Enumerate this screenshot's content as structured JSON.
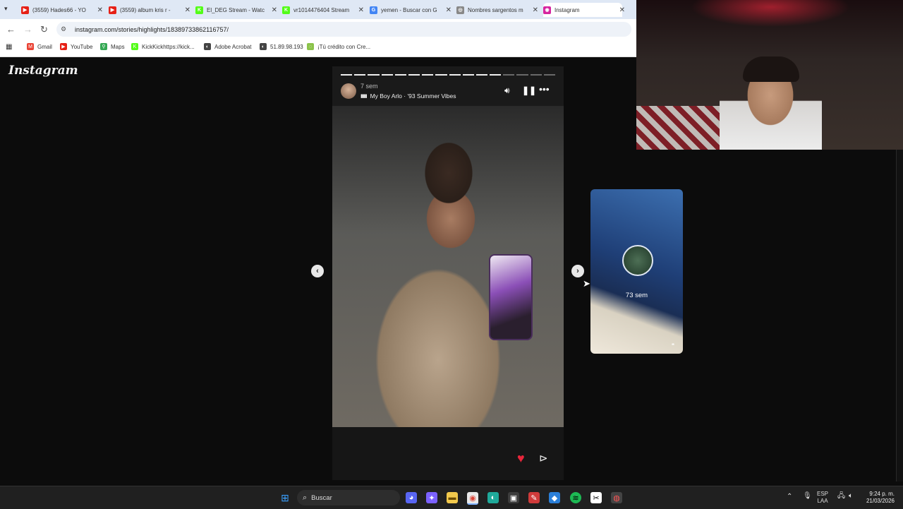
{
  "browser": {
    "tabs": [
      {
        "title": "(3559) Hades66 - YO",
        "color": "#e62117",
        "glyph": "▶"
      },
      {
        "title": "(3559) album kris r -",
        "color": "#e62117",
        "glyph": "▶"
      },
      {
        "title": "El_DEG Stream - Watc",
        "color": "#53fc18",
        "glyph": "K"
      },
      {
        "title": "vr1014476404 Stream",
        "color": "#53fc18",
        "glyph": "K"
      },
      {
        "title": "yemen - Buscar con G",
        "color": "#4285f4",
        "glyph": "G"
      },
      {
        "title": "Nombres sargentos m",
        "color": "#888888",
        "glyph": "◎"
      },
      {
        "title": "Instagram",
        "color": "#d6249f",
        "glyph": "◉"
      }
    ],
    "url": "instagram.com/stories/highlights/18389733862116757/",
    "bookmarks": [
      {
        "label": "Gmail",
        "color": "#ea4335",
        "glyph": "M"
      },
      {
        "label": "YouTube",
        "color": "#e62117",
        "glyph": "▶"
      },
      {
        "label": "Maps",
        "color": "#34a853",
        "glyph": "⚲"
      },
      {
        "label": "KickKickhttps://kick...",
        "color": "#53fc18",
        "glyph": "K"
      },
      {
        "label": "Adobe Acrobat",
        "color": "#444444",
        "glyph": "◐"
      },
      {
        "label": "51.89.98.193",
        "color": "#444444",
        "glyph": "◐"
      },
      {
        "label": "¡Tú crédito con Cre...",
        "color": "#8bc34a",
        "glyph": "◌"
      }
    ]
  },
  "instagram": {
    "logo": "Instagram",
    "story": {
      "age": "7 sem",
      "music": "My Boy Arlo · '93 Summer Vibes",
      "progress_segments": 16,
      "progress_done": 12,
      "colors": {
        "like": "#e8263b"
      }
    },
    "next_story": {
      "age": "73 sem"
    }
  },
  "taskbar": {
    "search_label": "Buscar",
    "language": [
      "ESP",
      "LAA"
    ],
    "time": "9:24 p. m.",
    "date": "21/03/2026"
  }
}
